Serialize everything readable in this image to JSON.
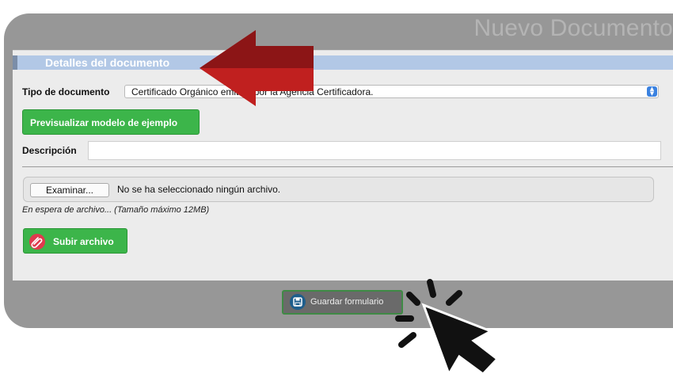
{
  "window": {
    "title": "Nuevo Documento"
  },
  "section": {
    "title": "Detalles del documento"
  },
  "doc_type": {
    "label": "Tipo de documento",
    "selected": "Certificado Orgánico emitido por la Agencia Certificadora."
  },
  "preview_button": {
    "label": "Previsualizar modelo de ejemplo"
  },
  "description": {
    "label": "Descripción",
    "value": ""
  },
  "file_upload": {
    "browse_label": "Examinar...",
    "status": "No se ha seleccionado ningún archivo.",
    "hint": "En espera de archivo... (Tamaño máximo 12MB)"
  },
  "upload_button": {
    "label": "Subir archivo"
  },
  "save_button": {
    "label": "Guardar formulario"
  },
  "colors": {
    "arrow": "#c0201f",
    "primary_green": "#3cb54a",
    "header_blue": "#b2c8e6",
    "cursor": "#111111"
  },
  "icons": {
    "select": "chevron-updown-icon",
    "upload": "paperclip-icon",
    "save": "floppy-disk-icon"
  }
}
